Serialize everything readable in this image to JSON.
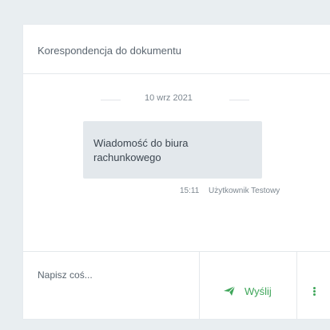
{
  "card": {
    "title": "Korespondencja do dokumentu"
  },
  "chat": {
    "date_separator": "10 wrz 2021",
    "messages": [
      {
        "text": "Wiadomość do biura rachunkowego",
        "time": "15:11",
        "author": "Użytkownik Testowy"
      }
    ]
  },
  "composer": {
    "placeholder": "Napisz coś...",
    "send_label": "Wyślij",
    "send_icon": "paper-plane-icon",
    "more_icon": "vertical-dots-icon"
  },
  "colors": {
    "background": "#e9eef1",
    "accent": "#3fa65a",
    "bubble": "#e3e8ec"
  }
}
